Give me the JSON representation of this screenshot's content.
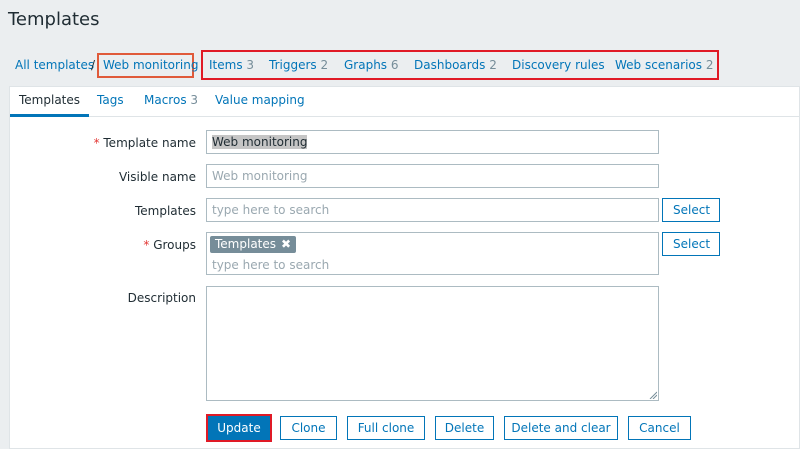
{
  "page": {
    "title": "Templates"
  },
  "breadcrumb": {
    "all_templates": "All templates",
    "separator": "/",
    "current": "Web monitoring"
  },
  "nav_links": [
    {
      "label": "Items",
      "count": "3"
    },
    {
      "label": "Triggers",
      "count": "2"
    },
    {
      "label": "Graphs",
      "count": "6"
    },
    {
      "label": "Dashboards",
      "count": "2"
    },
    {
      "label": "Discovery rules",
      "count": ""
    },
    {
      "label": "Web scenarios",
      "count": "2"
    }
  ],
  "tabs": [
    {
      "label": "Templates",
      "active": true
    },
    {
      "label": "Tags",
      "active": false
    },
    {
      "label": "Macros",
      "count": "3",
      "active": false
    },
    {
      "label": "Value mapping",
      "active": false
    }
  ],
  "form": {
    "required_mark": "*",
    "template_name": {
      "label": "Template name",
      "value": "Web monitoring"
    },
    "visible_name": {
      "label": "Visible name",
      "placeholder": "Web monitoring"
    },
    "templates": {
      "label": "Templates",
      "placeholder": "type here to search",
      "select_label": "Select"
    },
    "groups": {
      "label": "Groups",
      "chip": "Templates",
      "chip_remove": "✖",
      "placeholder": "type here to search",
      "select_label": "Select"
    },
    "description": {
      "label": "Description",
      "value": ""
    }
  },
  "actions": {
    "update": "Update",
    "clone": "Clone",
    "full_clone": "Full clone",
    "delete": "Delete",
    "delete_and_clear": "Delete and clear",
    "cancel": "Cancel"
  },
  "colors": {
    "accent": "#0275b8",
    "highlight_red": "#e01a26",
    "highlight_orange": "#e05a3a",
    "required": "#e33734"
  }
}
